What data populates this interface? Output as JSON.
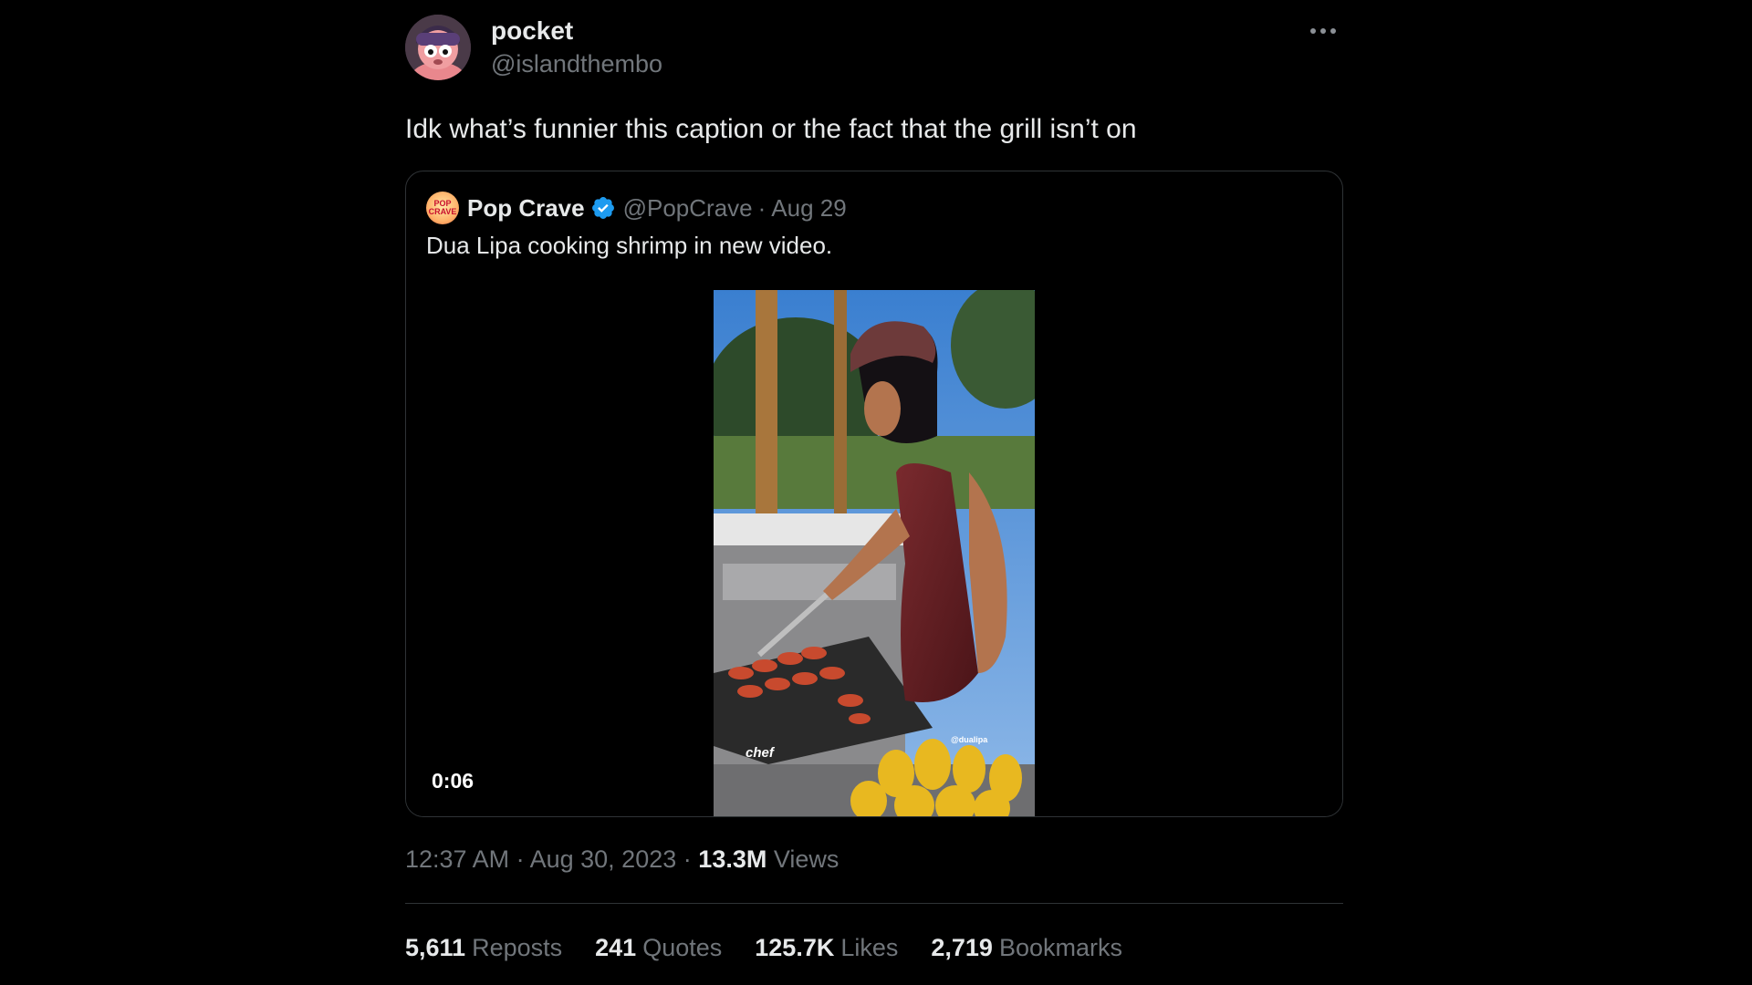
{
  "post": {
    "author": {
      "name": "pocket",
      "handle": "@islandthembo",
      "avatar_icon": "avatar-character-icon"
    },
    "more_icon": "more-horizontal-icon",
    "text": "Idk what’s funnier this caption or the fact that the grill isn’t on",
    "timestamp_time": "12:37 AM",
    "separator": "·",
    "timestamp_date": "Aug 30, 2023",
    "views_count": "13.3M",
    "views_label": "Views"
  },
  "quoted": {
    "name": "Pop Crave",
    "verified_icon": "verified-badge-icon",
    "verified_color": "#1d9bf0",
    "handle": "@PopCrave",
    "separator": "·",
    "date": "Aug 29",
    "text": "Dua Lipa cooking shrimp in new video.",
    "avatar_text": "POP\nCRAVE",
    "video": {
      "duration": "0:06",
      "overlay_text_left": "chef",
      "overlay_text_right": "@dualipa"
    }
  },
  "stats": [
    {
      "value": "5,611",
      "label": "Reposts"
    },
    {
      "value": "241",
      "label": "Quotes"
    },
    {
      "value": "125.7K",
      "label": "Likes"
    },
    {
      "value": "2,719",
      "label": "Bookmarks"
    }
  ],
  "colors": {
    "background": "#000000",
    "text_primary": "#e7e9ea",
    "text_secondary": "#71767b",
    "border": "#2f3336"
  }
}
